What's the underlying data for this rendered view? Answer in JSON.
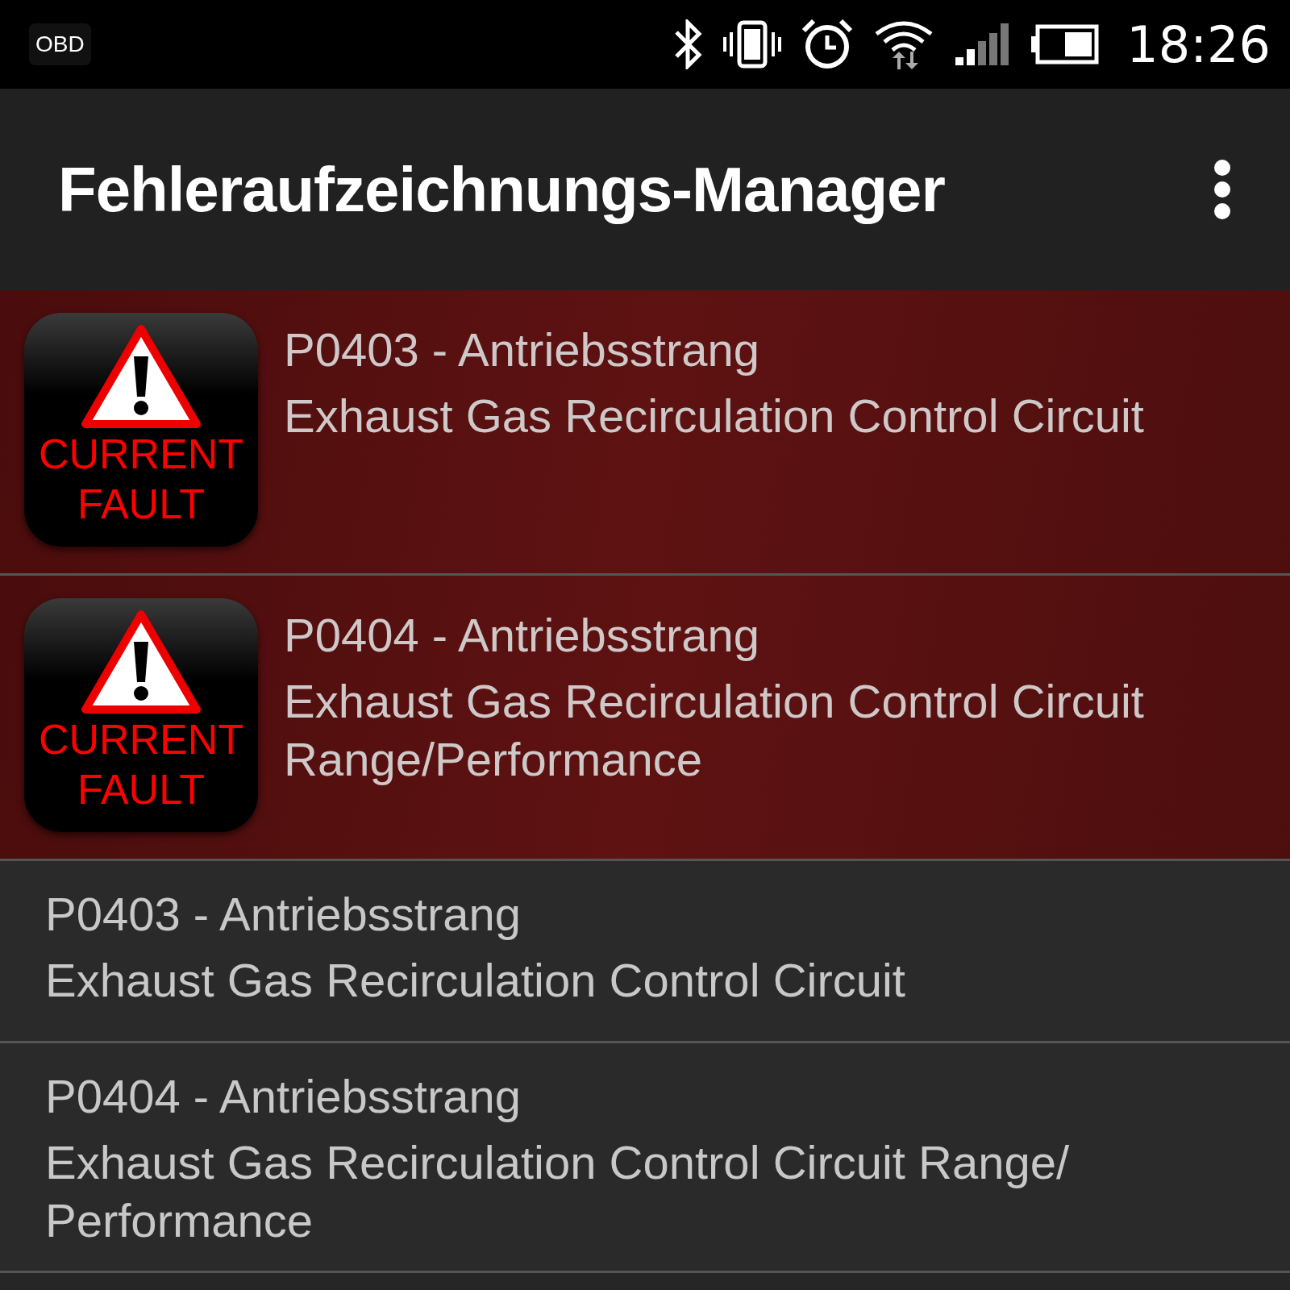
{
  "status_bar": {
    "app_label": "OBD",
    "time": "18:26"
  },
  "app_bar": {
    "title": "Fehleraufzeichnungs-Manager"
  },
  "faults": [
    {
      "kind": "current",
      "badge_lines": [
        "CURRENT",
        "FAULT"
      ],
      "code": "P0403 - Antriebsstrang",
      "description": "Exhaust Gas Recirculation Control Circuit"
    },
    {
      "kind": "current",
      "badge_lines": [
        "CURRENT",
        "FAULT"
      ],
      "code": "P0404 - Antriebsstrang",
      "description": "Exhaust Gas Recirculation Control Circuit Range/Performance"
    },
    {
      "kind": "stored",
      "code": "P0403 - Antriebsstrang",
      "description": "Exhaust Gas Recirculation Control Circuit"
    },
    {
      "kind": "stored",
      "code": "P0404 - Antriebsstrang",
      "description": "Exhaust Gas Recirculation Control Circuit Range/ Performance"
    }
  ]
}
